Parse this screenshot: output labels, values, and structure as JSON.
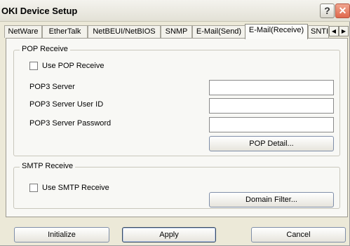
{
  "window": {
    "title": "OKI Device Setup",
    "help_label": "?",
    "close_label": "✕"
  },
  "tabs": [
    {
      "label": "NetWare",
      "active": false
    },
    {
      "label": "EtherTalk",
      "active": false
    },
    {
      "label": "NetBEUI/NetBIOS",
      "active": false
    },
    {
      "label": "SNMP",
      "active": false
    },
    {
      "label": "E-Mail(Send)",
      "active": false
    },
    {
      "label": "E-Mail(Receive)",
      "active": true
    },
    {
      "label": "SNTI",
      "active": false
    }
  ],
  "tab_scroll": {
    "left": "◀",
    "right": "▶"
  },
  "pop_receive": {
    "group_label": "POP Receive",
    "checkbox_label": "Use POP Receive",
    "checkbox_checked": false,
    "pop3_server_label": "POP3 Server",
    "pop3_server_value": "",
    "pop3_user_label": "POP3 Server User ID",
    "pop3_user_value": "",
    "pop3_password_label": "POP3 Server Password",
    "pop3_password_value": "",
    "detail_button": "POP Detail..."
  },
  "smtp_receive": {
    "group_label": "SMTP Receive",
    "checkbox_label": "Use SMTP Receive",
    "checkbox_checked": false,
    "domain_filter_button": "Domain Filter..."
  },
  "footer": {
    "initialize_label": "Initialize",
    "apply_label": "Apply",
    "cancel_label": "Cancel"
  }
}
